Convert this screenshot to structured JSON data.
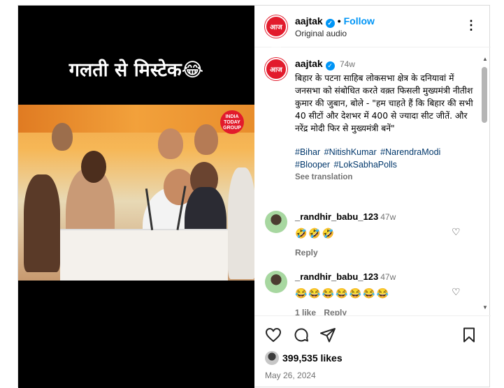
{
  "media": {
    "overlay_caption": "गलती से मिस्टेक😂",
    "watermark": "INDIA TODAY GROUP"
  },
  "header": {
    "username": "aajtak",
    "verified_glyph": "✓",
    "separator": "•",
    "follow_label": "Follow",
    "audio": "Original audio",
    "more_glyph": "⋮",
    "logo_text": "आज तक"
  },
  "post": {
    "username": "aajtak",
    "verified_glyph": "✓",
    "time": "74w",
    "text": "बिहार के पटना साहिब लोकसभा क्षेत्र के दनियावां में जनसभा को संबोधित करते वक़्त फिसली मुख्यमंत्री नीतीश कुमार की जुबान, बोले - \"हम चाहते हैं कि बिहार की सभी 40 सीटों और देशभर में 400 से ज्यादा सीट जीतें. और नरेंद्र मोदी फिर से मुख्यमंत्री बनें\"",
    "hashtags": [
      "#Bihar",
      "#NitishKumar",
      "#NarendraModi",
      "#Blooper",
      "#LokSabhaPolls"
    ],
    "see_translation": "See translation"
  },
  "comments": [
    {
      "username": "_randhir_babu_123",
      "time": "47w",
      "text": "🤣🤣🤣",
      "actions": [
        "Reply"
      ],
      "heart_glyph": "♡"
    },
    {
      "username": "_randhir_babu_123",
      "time": "47w",
      "text": "😂😂😂😂😂😂😂",
      "actions": [
        "1 like",
        "Reply"
      ],
      "heart_glyph": "♡"
    }
  ],
  "scrollbar": {
    "up": "▲",
    "down": "▼"
  },
  "footer": {
    "likes": "399,535 likes",
    "date": "May 26, 2024"
  },
  "icons": {
    "like": "heart-icon",
    "comment": "comment-icon",
    "share": "share-icon",
    "save": "bookmark-icon"
  }
}
